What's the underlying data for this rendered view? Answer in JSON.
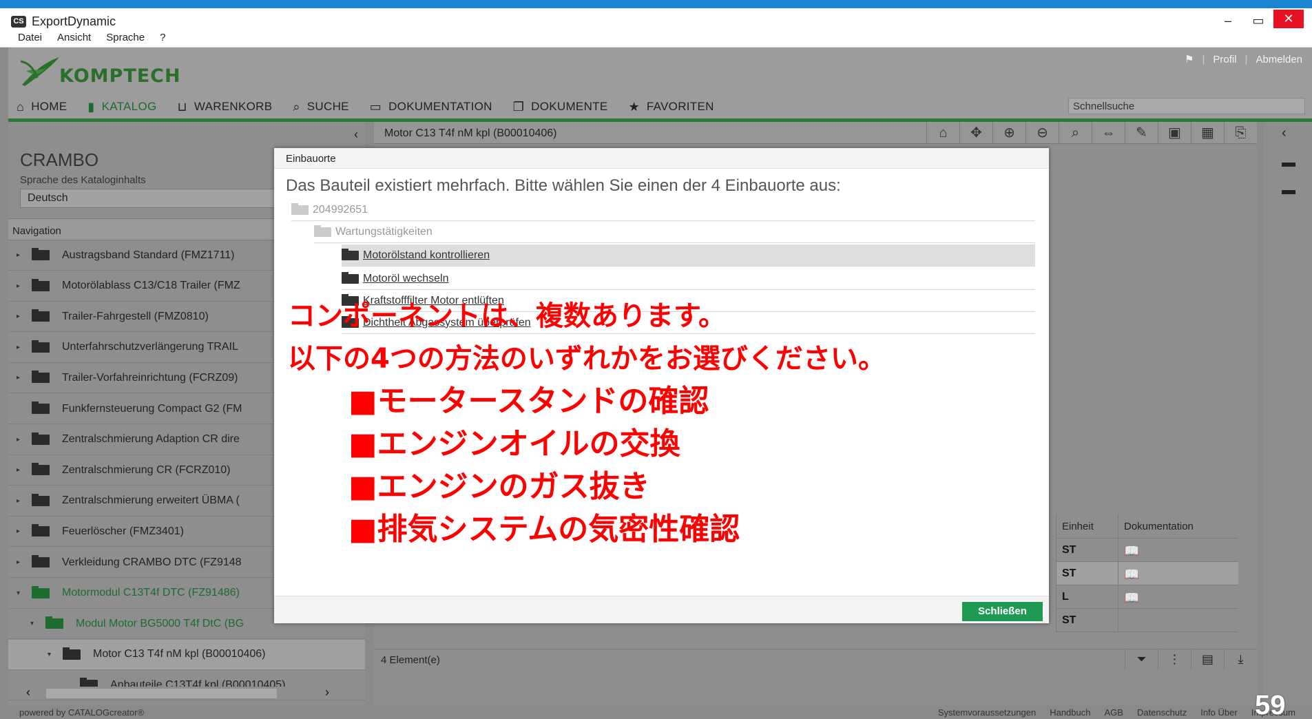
{
  "window": {
    "title": "ExportDynamic",
    "app_icon": "CS",
    "minimize": "–",
    "maximize": "▭",
    "close": "✕"
  },
  "menu": [
    "Datei",
    "Ansicht",
    "Sprache",
    "?"
  ],
  "header": {
    "logo_text": "KOMPTECH",
    "links": {
      "profile": "Profil",
      "logout": "Abmelden"
    },
    "nav": [
      {
        "icon": "home-icon",
        "label": "HOME"
      },
      {
        "icon": "catalog-icon",
        "label": "KATALOG"
      },
      {
        "icon": "cart-icon",
        "label": "WARENKORB"
      },
      {
        "icon": "search-icon",
        "label": "SUCHE"
      },
      {
        "icon": "book-icon",
        "label": "DOKUMENTATION"
      },
      {
        "icon": "documents-icon",
        "label": "DOKUMENTE"
      },
      {
        "icon": "star-icon",
        "label": "FAVORITEN"
      }
    ],
    "quicksearch_placeholder": "Schnellsuche"
  },
  "left": {
    "catalog_title": "CRAMBO",
    "language_label": "Sprache des Kataloginhalts",
    "language_value": "Deutsch",
    "navigation_label": "Navigation",
    "items": [
      {
        "label": "Austragsband Standard (FMZ1711)",
        "caret": "▸",
        "state": "normal"
      },
      {
        "label": "Motorölablass C13/C18 Trailer (FMZ",
        "caret": "▸",
        "state": "normal"
      },
      {
        "label": "Trailer-Fahrgestell (FMZ0810)",
        "caret": "▸",
        "state": "normal"
      },
      {
        "label": "Unterfahrschutzverlängerung TRAIL",
        "caret": "▸",
        "state": "normal"
      },
      {
        "label": "Trailer-Vorfahreinrichtung (FCRZ09)",
        "caret": "▸",
        "state": "normal"
      },
      {
        "label": "Funkfernsteuerung Compact G2 (FM",
        "caret": "",
        "state": "normal"
      },
      {
        "label": "Zentralschmierung Adaption CR dire",
        "caret": "▸",
        "state": "normal"
      },
      {
        "label": "Zentralschmierung CR (FCRZ010)",
        "caret": "▸",
        "state": "normal"
      },
      {
        "label": "Zentralschmierung erweitert ÜBMA (",
        "caret": "▸",
        "state": "normal"
      },
      {
        "label": "Feuerlöscher (FMZ3401)",
        "caret": "▸",
        "state": "normal"
      },
      {
        "label": "Verkleidung CRAMBO DTC (FZ9148",
        "caret": "▸",
        "state": "normal"
      },
      {
        "label": "Motormodul C13T4f DTC (FZ91486)",
        "caret": "▾",
        "state": "green"
      },
      {
        "label": "Modul Motor BG5000 T4f DtC (BG",
        "caret": "▾",
        "state": "green"
      },
      {
        "label": "Motor C13 T4f nM kpl (B00010406)",
        "caret": "▾",
        "state": "selected"
      },
      {
        "label": "Anbauteile C13T4f kpl (B00010405)",
        "caret": "",
        "state": "normal"
      }
    ]
  },
  "center": {
    "title": "Motor C13 T4f nM kpl (B00010406)",
    "toolbar_icons": [
      "home-icon",
      "move-icon",
      "zoom-in-icon",
      "zoom-out-icon",
      "zoom-icon",
      "fit-icon",
      "pen-icon",
      "image-icon",
      "table-icon",
      "pdf-icon"
    ],
    "table": {
      "headers": [
        "Einheit",
        "Dokumentation"
      ],
      "rows": [
        {
          "unit": "ST",
          "doc": "📖"
        },
        {
          "unit": "ST",
          "doc": "📖"
        },
        {
          "unit": "L",
          "doc": "📖"
        },
        {
          "unit": "ST",
          "doc": ""
        }
      ]
    },
    "status": "4 Element(e)"
  },
  "modal": {
    "title": "Einbauorte",
    "message": "Das Bauteil existiert mehrfach. Bitte wählen Sie einen der 4 Einbauorte aus:",
    "tree": [
      {
        "label": "204992651",
        "level": 0,
        "style": "grey"
      },
      {
        "label": "Wartungstätigkeiten",
        "level": 1,
        "style": "grey"
      },
      {
        "label": "Motorölstand kontrollieren",
        "level": 2,
        "style": "link-hl"
      },
      {
        "label": "Motoröl wechseln",
        "level": 2,
        "style": "link"
      },
      {
        "label": "Kraftstofffilter Motor entlüften",
        "level": 2,
        "style": "link"
      },
      {
        "label": "Dichtheit Abgassystem überprüfen",
        "level": 2,
        "style": "link"
      }
    ],
    "close_label": "Schließen"
  },
  "annotation": {
    "line1": "コンポーネントは、複数あります。",
    "line2": "以下の4つの方法のいずれかをお選びください。",
    "items": [
      "■モータースタンドの確認",
      "■エンジンオイルの交換",
      "■エンジンのガス抜き",
      "■排気システムの気密性確認"
    ]
  },
  "footer": {
    "powered": "powered by CATALOGcreator®",
    "links": [
      "Systemvoraussetzungen",
      "Handbuch",
      "AGB",
      "Datenschutz",
      "Info Über",
      "Impressum"
    ]
  },
  "page_number": "59"
}
